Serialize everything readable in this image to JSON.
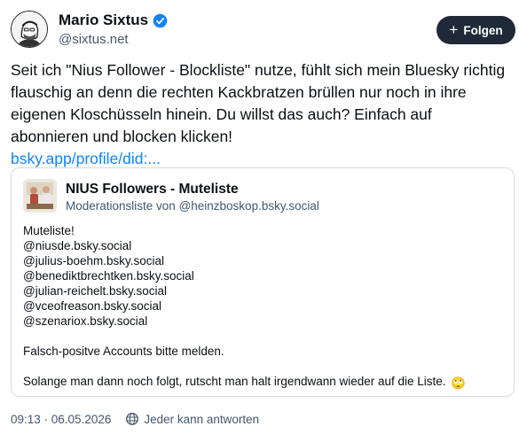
{
  "author": {
    "display_name": "Mario Sixtus",
    "handle": "@sixtus.net",
    "avatar_icon": "profile-avatar",
    "verified_icon": "verified-check-icon",
    "verified_color": "#1083fe"
  },
  "follow_button": {
    "label": "Folgen",
    "icon": "plus-icon"
  },
  "post": {
    "text": "Seit ich \"Nius Follower - Blockliste\" nutze, fühlt sich mein Bluesky richtig flauschig an denn die rechten Kackbratzen brüllen nur noch in ihre eigenen Kloschüsseln hinein. Du willst das auch? Einfach auf abonnieren und blocken klicken!",
    "link": "bsky.app/profile/did:..."
  },
  "embed": {
    "title": "NIUS Followers - Muteliste",
    "subtitle": "Moderationsliste von @heinzboskop.bsky.social",
    "description_lines": [
      "Muteliste!",
      "@niusde.bsky.social",
      "@julius-boehm.bsky.social",
      "@benediktbrechtken.bsky.social",
      "@julian-reichelt.bsky.social",
      "@vceofreason.bsky.social",
      "@szenariox.bsky.social",
      "",
      "Falsch-positve Accounts bitte melden.",
      "",
      "Solange man dann noch folgt, rutscht man halt irgendwann wieder auf die Liste."
    ],
    "emoji": "🙄"
  },
  "meta": {
    "timestamp": "09:13 · 06.05.2026",
    "reply_setting": "Jeder kann antworten",
    "reply_icon": "globe-icon"
  },
  "colors": {
    "accent": "#1083fe",
    "button_bg": "#1f2937",
    "muted_text": "#42576c",
    "border": "#d4dbe2"
  }
}
